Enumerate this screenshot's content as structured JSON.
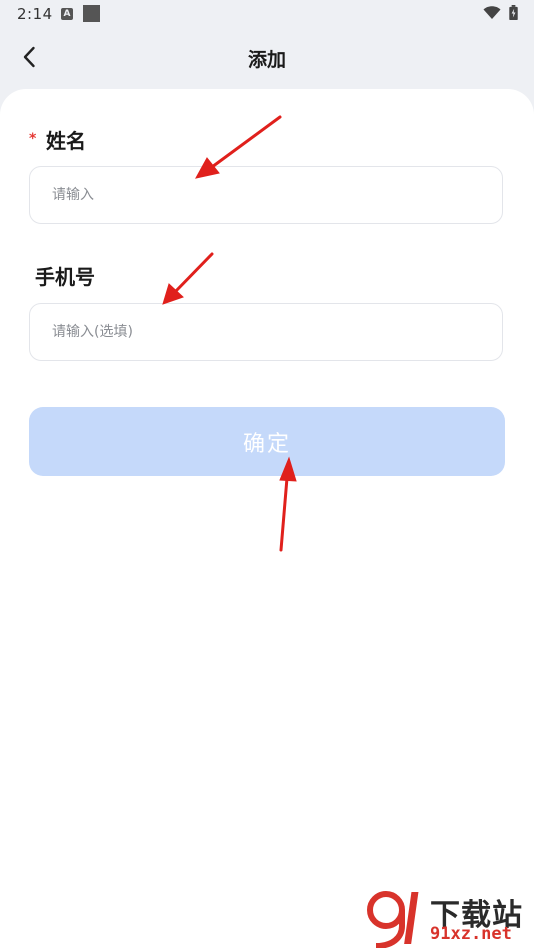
{
  "status_bar": {
    "time": "2:14",
    "notification_icon_letter": "A",
    "icons": [
      "a-notification-icon",
      "square-notification-icon",
      "wifi-icon",
      "battery-icon"
    ]
  },
  "app_bar": {
    "title": "添加",
    "back_icon": "chevron-left-icon"
  },
  "form": {
    "name_field": {
      "required_mark": "*",
      "label": "姓名",
      "placeholder": "请输入",
      "value": ""
    },
    "phone_field": {
      "label": "手机号",
      "placeholder": "请输入(选填)",
      "value": ""
    },
    "confirm_label": "确定"
  },
  "annotations": {
    "arrow_color": "#e0201c"
  },
  "watermark": {
    "text_top": "下载站",
    "text_bottom": "91xz.net",
    "logo_text": "91",
    "colors": {
      "red": "#d8332b",
      "dark": "#2a2a2a"
    }
  },
  "colors": {
    "background": "#eef0f4",
    "card": "#ffffff",
    "button_disabled": "#c5d9fa",
    "required": "#e53935"
  }
}
